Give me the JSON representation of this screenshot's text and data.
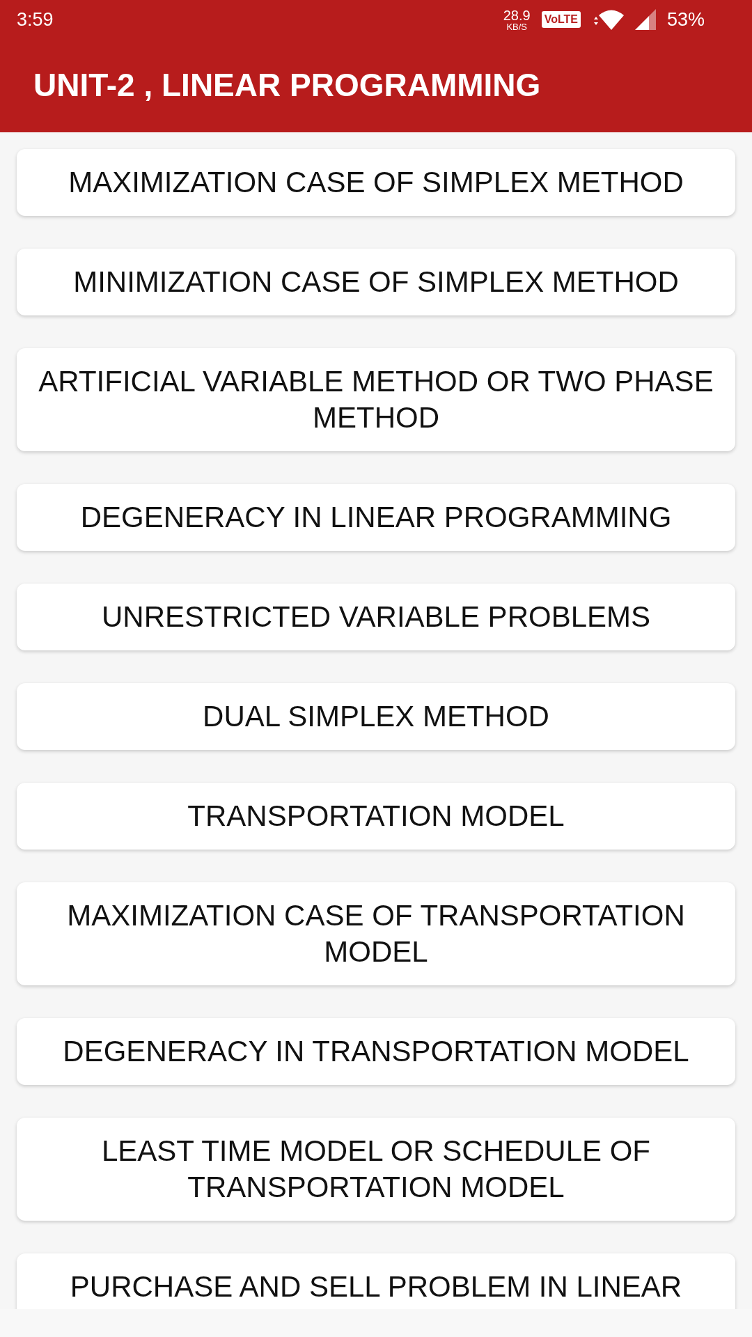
{
  "status_bar": {
    "time": "3:59",
    "data_rate": "28.9",
    "data_rate_unit": "KB/S",
    "network_badge": "VoLTE",
    "battery": "53%"
  },
  "app_bar": {
    "title": "UNIT-2 , LINEAR PROGRAMMING"
  },
  "topics": [
    "MAXIMIZATION CASE OF SIMPLEX METHOD",
    "MINIMIZATION CASE OF SIMPLEX METHOD",
    "ARTIFICIAL VARIABLE METHOD OR TWO PHASE METHOD",
    "DEGENERACY IN LINEAR PROGRAMMING",
    "UNRESTRICTED VARIABLE PROBLEMS",
    "DUAL SIMPLEX METHOD",
    "TRANSPORTATION MODEL",
    "MAXIMIZATION CASE OF TRANSPORTATION MODEL",
    "DEGENERACY IN TRANSPORTATION MODEL",
    "LEAST TIME MODEL OR SCHEDULE OF TRANSPORTATION MODEL",
    "PURCHASE AND SELL PROBLEM IN LINEAR"
  ]
}
